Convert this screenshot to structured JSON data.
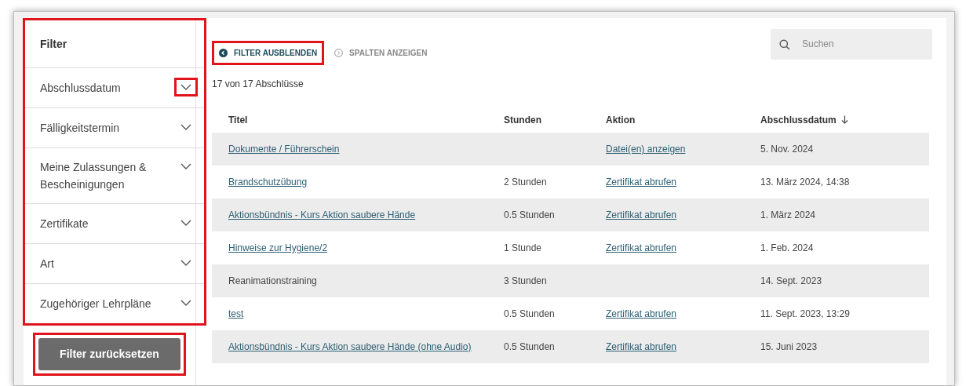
{
  "filter_panel": {
    "title": "Filter",
    "highlighted": true,
    "items": [
      {
        "label": "Abschlussdatum",
        "expanded": false,
        "chevron_highlighted": true
      },
      {
        "label": "Fälligkeitstermin",
        "expanded": false,
        "chevron_highlighted": false
      },
      {
        "label": "Meine Zulassungen & Bescheinigungen",
        "expanded": false,
        "chevron_highlighted": false
      },
      {
        "label": "Zertifikate",
        "expanded": false,
        "chevron_highlighted": false
      },
      {
        "label": "Art",
        "expanded": false,
        "chevron_highlighted": false
      },
      {
        "label": "Zugehöriger Lehrpläne",
        "expanded": false,
        "chevron_highlighted": false
      }
    ],
    "reset_button": {
      "label": "Filter zurücksetzen",
      "highlighted": true
    }
  },
  "toolbar": {
    "buttons": [
      {
        "label": "FILTER AUSBLENDEN",
        "kind": "hide",
        "highlighted": true
      },
      {
        "label": "SPALTEN ANZEIGEN",
        "kind": "show",
        "highlighted": false
      }
    ],
    "search": {
      "placeholder": "Suchen"
    }
  },
  "result_count": "17 von 17 Abschlüsse",
  "table": {
    "columns": [
      {
        "label": "Titel",
        "sorted": false
      },
      {
        "label": "Stunden",
        "sorted": false
      },
      {
        "label": "Aktion",
        "sorted": false
      },
      {
        "label": "Abschlussdatum",
        "sorted": true
      }
    ],
    "rows": [
      {
        "title": "Dokumente / Führerschein",
        "title_link": true,
        "hours": "",
        "action": "Datei(en) anzeigen",
        "date": "5. Nov. 2024"
      },
      {
        "title": "Brandschutzübung",
        "title_link": true,
        "hours": "2 Stunden",
        "action": "Zertifikat abrufen",
        "date": "13. März 2024, 14:38"
      },
      {
        "title": "Aktionsbündnis - Kurs Aktion saubere Hände",
        "title_link": true,
        "hours": "0.5 Stunden",
        "action": "Zertifikat abrufen",
        "date": "1. März 2024"
      },
      {
        "title": "Hinweise zur Hygiene/2",
        "title_link": true,
        "hours": "1 Stunde",
        "action": "Zertifikat abrufen",
        "date": "1. Feb. 2024"
      },
      {
        "title": "Reanimationstraining",
        "title_link": false,
        "hours": "3 Stunden",
        "action": "",
        "date": "14. Sept. 2023"
      },
      {
        "title": "test",
        "title_link": true,
        "hours": "0.5 Stunden",
        "action": "Zertifikat abrufen",
        "date": "11. Sept. 2023, 13:29"
      },
      {
        "title": "Aktionsbündnis - Kurs Aktion saubere Hände (ohne Audio)",
        "title_link": true,
        "hours": "0.5 Stunden",
        "action": "Zertifikat abrufen",
        "date": "15. Juni 2023"
      }
    ]
  }
}
